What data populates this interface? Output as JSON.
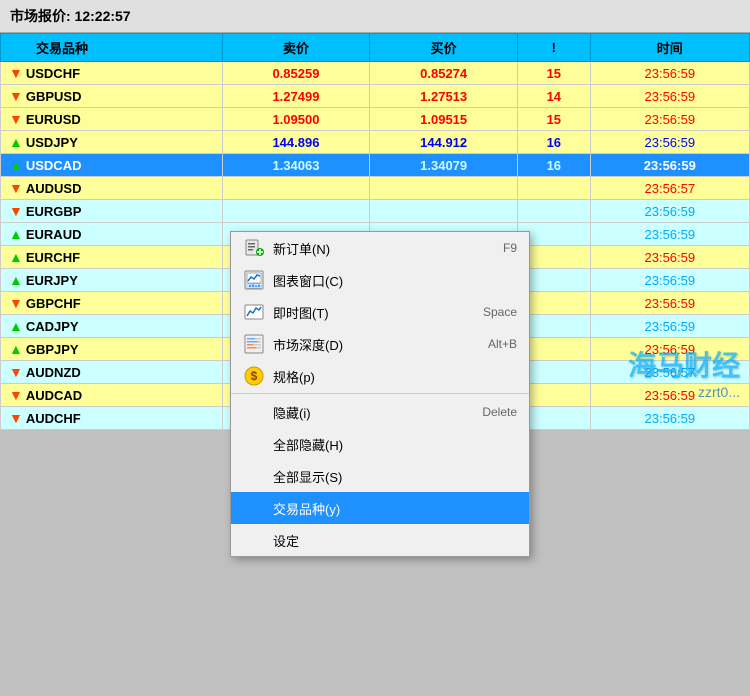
{
  "titleBar": {
    "label": "市场报价: 12:22:57"
  },
  "table": {
    "headers": {
      "symbol": "交易品种",
      "sell": "卖价",
      "buy": "买价",
      "exclamation": "!",
      "time": "时间"
    },
    "rows": [
      {
        "id": "usdchf",
        "symbol": "USDCHF",
        "direction": "down",
        "sell": "0.85259",
        "buy": "0.85274",
        "points": "15",
        "time": "23:56:59",
        "rowStyle": "yellow",
        "priceColor": "red",
        "timeColor": "red"
      },
      {
        "id": "gbpusd",
        "symbol": "GBPUSD",
        "direction": "down",
        "sell": "1.27499",
        "buy": "1.27513",
        "points": "14",
        "time": "23:56:59",
        "rowStyle": "yellow",
        "priceColor": "red",
        "timeColor": "red"
      },
      {
        "id": "eurusd",
        "symbol": "EURUSD",
        "direction": "down",
        "sell": "1.09500",
        "buy": "1.09515",
        "points": "15",
        "time": "23:56:59",
        "rowStyle": "yellow",
        "priceColor": "red",
        "timeColor": "red"
      },
      {
        "id": "usdjpy",
        "symbol": "USDJPY",
        "direction": "up",
        "sell": "144.896",
        "buy": "144.912",
        "points": "16",
        "time": "23:56:59",
        "rowStyle": "yellow",
        "priceColor": "blue",
        "timeColor": "blue"
      },
      {
        "id": "usdcad",
        "symbol": "USDCAD",
        "direction": "up",
        "sell": "1.34063",
        "buy": "1.34079",
        "points": "16",
        "time": "23:56:59",
        "rowStyle": "highlighted",
        "priceColor": "white",
        "timeColor": "white"
      },
      {
        "id": "audusd",
        "symbol": "AUDUSD",
        "direction": "down",
        "sell": "",
        "buy": "",
        "points": "",
        "time": "23:56:57",
        "rowStyle": "yellow",
        "priceColor": "red",
        "timeColor": "red"
      },
      {
        "id": "eurgbp",
        "symbol": "EURGBP",
        "direction": "down",
        "sell": "",
        "buy": "",
        "points": "",
        "time": "23:56:59",
        "rowStyle": "cyan",
        "priceColor": "blue",
        "timeColor": "cyan"
      },
      {
        "id": "euraud",
        "symbol": "EURAUD",
        "direction": "up",
        "sell": "",
        "buy": "",
        "points": "",
        "time": "23:56:59",
        "rowStyle": "cyan",
        "priceColor": "blue",
        "timeColor": "cyan"
      },
      {
        "id": "eurchf",
        "symbol": "EURCHF",
        "direction": "up",
        "sell": "",
        "buy": "",
        "points": "",
        "time": "23:56:59",
        "rowStyle": "yellow",
        "priceColor": "red",
        "timeColor": "red"
      },
      {
        "id": "eurjpy",
        "symbol": "EURJPY",
        "direction": "up",
        "sell": "",
        "buy": "",
        "points": "",
        "time": "23:56:59",
        "rowStyle": "cyan",
        "priceColor": "blue",
        "timeColor": "cyan"
      },
      {
        "id": "gbpchf",
        "symbol": "GBPCHF",
        "direction": "down",
        "sell": "",
        "buy": "",
        "points": "",
        "time": "23:56:59",
        "rowStyle": "yellow",
        "priceColor": "red",
        "timeColor": "red"
      },
      {
        "id": "cadjpy",
        "symbol": "CADJPY",
        "direction": "up",
        "sell": "",
        "buy": "",
        "points": "",
        "time": "23:56:59",
        "rowStyle": "cyan",
        "priceColor": "blue",
        "timeColor": "cyan"
      },
      {
        "id": "gbpjpy",
        "symbol": "GBPJPY",
        "direction": "up",
        "sell": "",
        "buy": "",
        "points": "",
        "time": "23:56:59",
        "rowStyle": "yellow",
        "priceColor": "red",
        "timeColor": "red"
      },
      {
        "id": "audnzd",
        "symbol": "AUDNZD",
        "direction": "down",
        "sell": "",
        "buy": "",
        "points": "",
        "time": "23:56:57",
        "rowStyle": "cyan",
        "priceColor": "blue",
        "timeColor": "cyan"
      },
      {
        "id": "audcad",
        "symbol": "AUDCAD",
        "direction": "down",
        "sell": "",
        "buy": "",
        "points": "",
        "time": "23:56:59",
        "rowStyle": "yellow",
        "priceColor": "red",
        "timeColor": "red"
      },
      {
        "id": "audchf",
        "symbol": "AUDCHF",
        "direction": "down",
        "sell": "",
        "buy": "",
        "points": "",
        "time": "23:56:59",
        "rowStyle": "cyan",
        "priceColor": "blue",
        "timeColor": "cyan"
      }
    ]
  },
  "contextMenu": {
    "items": [
      {
        "id": "new-order",
        "icon": "📋+",
        "iconType": "new-order",
        "label": "新订单(N)",
        "shortcut": "F9",
        "separator": false
      },
      {
        "id": "chart-window",
        "icon": "📊",
        "iconType": "chart",
        "label": "图表窗口(C)",
        "shortcut": "",
        "separator": false
      },
      {
        "id": "quick-chart",
        "icon": "📈",
        "iconType": "quickchart",
        "label": "即时图(T)",
        "shortcut": "Space",
        "separator": false
      },
      {
        "id": "market-depth",
        "icon": "🔢",
        "iconType": "depth",
        "label": "市场深度(D)",
        "shortcut": "Alt+B",
        "separator": false
      },
      {
        "id": "spec",
        "icon": "$",
        "iconType": "spec",
        "label": "规格(p)",
        "shortcut": "",
        "separator": true
      },
      {
        "id": "hide",
        "icon": "",
        "iconType": "none",
        "label": "隐藏(i)",
        "shortcut": "Delete",
        "separator": false
      },
      {
        "id": "hide-all",
        "icon": "",
        "iconType": "none",
        "label": "全部隐藏(H)",
        "shortcut": "",
        "separator": false
      },
      {
        "id": "show-all",
        "icon": "",
        "iconType": "none",
        "label": "全部显示(S)",
        "shortcut": "",
        "separator": false
      },
      {
        "id": "trade-symbol",
        "icon": "",
        "iconType": "none",
        "label": "交易品种(y)",
        "shortcut": "",
        "separator": false,
        "highlighted": true
      },
      {
        "id": "settings",
        "icon": "",
        "iconType": "none",
        "label": "设定",
        "shortcut": "",
        "separator": false
      }
    ]
  },
  "watermark": {
    "line1": "海马财经",
    "line2": "zzrt0..."
  }
}
